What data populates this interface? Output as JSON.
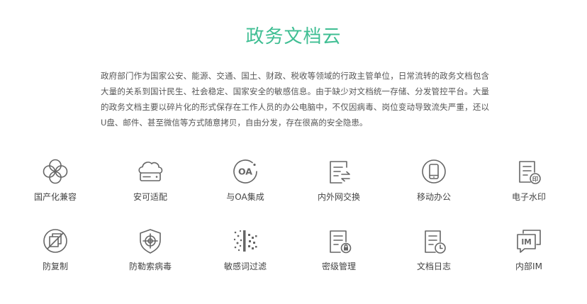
{
  "section": {
    "title": "政务文档云",
    "description": "政府部门作为国家公安、能源、交通、国土、财政、税收等领域的行政主管单位，日常流转的政务文档包含大量的关系到国计民生、社会稳定、国家安全的敏感信息。由于缺少对文档统一存储、分发管控平台。大量的政务文档主要以碎片化的形式保存在工作人员的办公电脑中，不仅因病毒、岗位变动导致流失严重，还以U盘、邮件、甚至微信等方式随意拷贝，自由分发，存在很高的安全隐患。"
  },
  "features": [
    {
      "label": "国产化兼容",
      "icon": "clover-icon"
    },
    {
      "label": "安可适配",
      "icon": "cloud-server-icon"
    },
    {
      "label": "与OA集成",
      "icon": "oa-icon",
      "icon_text": "OA"
    },
    {
      "label": "内外网交换",
      "icon": "document-exchange-icon"
    },
    {
      "label": "移动办公",
      "icon": "mobile-phone-icon"
    },
    {
      "label": "电子水印",
      "icon": "document-stamp-icon",
      "icon_text": "印"
    },
    {
      "label": "防复制",
      "icon": "no-copy-icon"
    },
    {
      "label": "防勒索病毒",
      "icon": "shield-target-icon"
    },
    {
      "label": "敏感词过滤",
      "icon": "filter-particles-icon"
    },
    {
      "label": "密级管理",
      "icon": "document-lock-icon"
    },
    {
      "label": "文档日志",
      "icon": "document-clock-icon"
    },
    {
      "label": "内部IM",
      "icon": "chat-im-icon",
      "icon_text": "IM"
    }
  ]
}
